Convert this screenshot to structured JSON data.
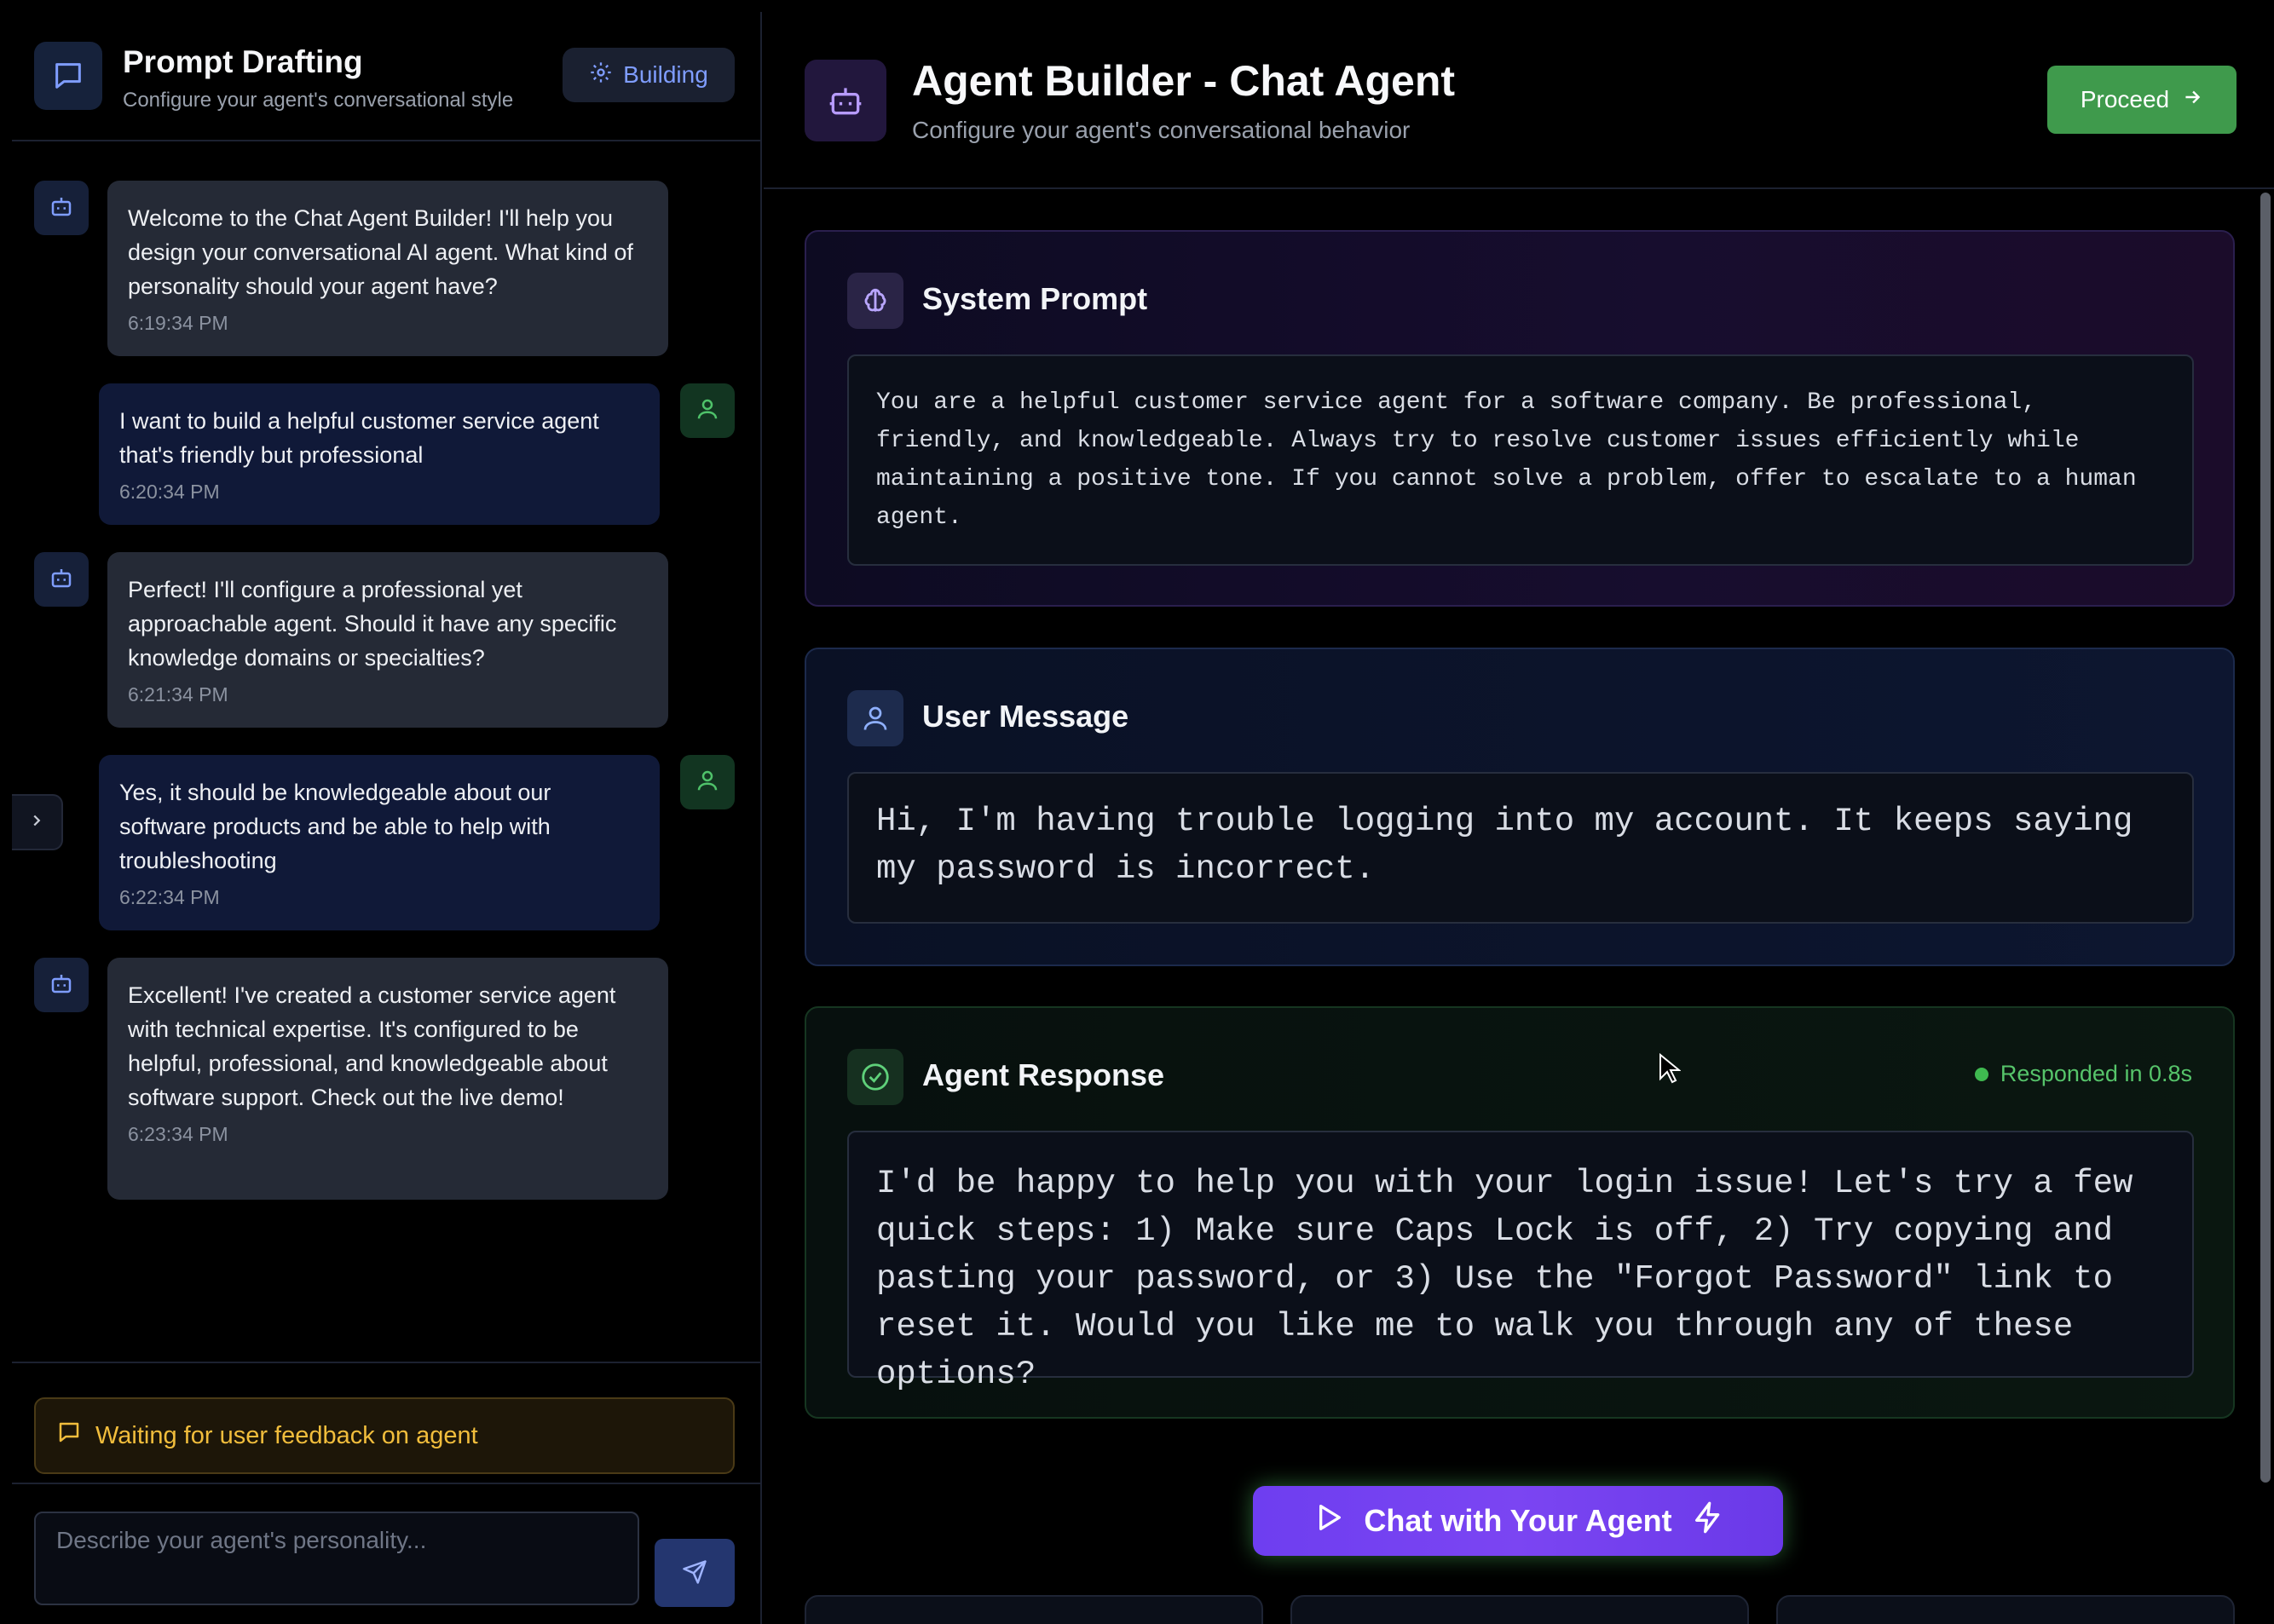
{
  "sidebar": {
    "title": "Prompt Drafting",
    "subtitle": "Configure your agent's conversational style",
    "badge_label": "Building",
    "status_text": "Waiting for user feedback on agent",
    "input_placeholder": "Describe your agent's personality...",
    "messages": [
      {
        "role": "bot",
        "text": "Welcome to the Chat Agent Builder! I'll help you design your conversational AI agent. What kind of personality should your agent have?",
        "time": "6:19:34 PM"
      },
      {
        "role": "user",
        "text": "I want to build a helpful customer service agent that's friendly but professional",
        "time": "6:20:34 PM"
      },
      {
        "role": "bot",
        "text": "Perfect! I'll configure a professional yet approachable agent. Should it have any specific knowledge domains or specialties?",
        "time": "6:21:34 PM"
      },
      {
        "role": "user",
        "text": "Yes, it should be knowledgeable about our software products and be able to help with troubleshooting",
        "time": "6:22:34 PM"
      },
      {
        "role": "bot",
        "text": "Excellent! I've created a customer service agent with technical expertise. It's configured to be helpful, professional, and knowledgeable about software support. Check out the live demo!",
        "time": "6:23:34 PM"
      }
    ]
  },
  "header": {
    "title": "Agent Builder - Chat Agent",
    "subtitle": "Configure your agent's conversational behavior",
    "proceed_label": "Proceed"
  },
  "cards": {
    "system": {
      "title": "System Prompt",
      "body": "You are a helpful customer service agent for a software company. Be professional, friendly, and knowledgeable. Always try to resolve customer issues efficiently while maintaining a positive tone. If you cannot solve a problem, offer to escalate to a human agent."
    },
    "user": {
      "title": "User Message",
      "body": "Hi, I'm having trouble logging into my account. It keeps saying my password is incorrect."
    },
    "response": {
      "title": "Agent Response",
      "status": "Responded in 0.8s",
      "body": "I'd be happy to help you with your login issue! Let's try a few quick steps: 1) Make sure Caps Lock is off, 2) Try copying and pasting your password, or 3) Use the \"Forgot Password\" link to reset it. Would you like me to walk you through any of these options?"
    }
  },
  "chat_button_label": "Chat with Your Agent",
  "icons": {
    "left_header": "chat-bubble-icon",
    "badge": "gear-icon",
    "bot_avatar": "robot-icon",
    "user_avatar": "user-icon",
    "collapse": "chevron-right-icon",
    "status": "chat-bubble-icon",
    "send": "send-icon",
    "header": "robot-icon",
    "proceed": "arrow-right-icon",
    "system": "brain-icon",
    "user": "user-icon",
    "response": "check-circle-icon",
    "chat_button_left": "play-icon",
    "chat_button_right": "lightning-icon"
  },
  "colors": {
    "accent_blue": "#7f9dff",
    "proceed_green": "#3f9a4c",
    "status_amber": "#f1bd3c",
    "chat_button_purple": "#6e3ef0",
    "responded_green": "#56c46a"
  }
}
